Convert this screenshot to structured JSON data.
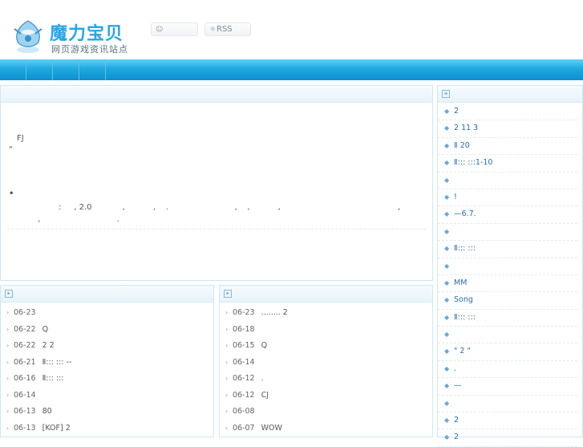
{
  "header": {
    "logo_title": "魔力宝贝",
    "logo_subtitle": "网页游戏资讯站点",
    "user_box_icon": "user-icon",
    "user_box_text": "",
    "rss_icon": "feed-icon",
    "rss_label": "RSS"
  },
  "nav": {
    "items": [
      "",
      "",
      "",
      ""
    ]
  },
  "intro": {
    "lines": [
      "FJ",
      "\"",
      "•",
      ":     , 2.0            ,           ,    .                          ,    ,           ,                                              ,",
      ",                              ."
    ]
  },
  "news_left": [
    {
      "date": "06-23",
      "title": ""
    },
    {
      "date": "06-22",
      "title": "Q"
    },
    {
      "date": "06-22",
      "title": "2     2"
    },
    {
      "date": "06-21",
      "title": "Ⅱ:::  :::  --"
    },
    {
      "date": "06-16",
      "title": "Ⅱ:::  :::"
    },
    {
      "date": "06-14",
      "title": ""
    },
    {
      "date": "06-13",
      "title": "80"
    },
    {
      "date": "06-13",
      "title": "[KOF]    2"
    }
  ],
  "news_right": [
    {
      "date": "06-23",
      "title": "........     2"
    },
    {
      "date": "06-18",
      "title": ""
    },
    {
      "date": "06-15",
      "title": "Q"
    },
    {
      "date": "06-14",
      "title": ""
    },
    {
      "date": "06-12",
      "title": "."
    },
    {
      "date": "06-12",
      "title": "CJ"
    },
    {
      "date": "06-08",
      "title": ""
    },
    {
      "date": "06-07",
      "title": "WOW"
    }
  ],
  "sidebar": [
    "2",
    "2       11 3",
    "Ⅱ 20",
    "Ⅱ:::   :::1-10",
    "",
    "   !",
    "—6.7.",
    "",
    "Ⅱ:::   :::",
    "",
    "MM",
    "         Song",
    "Ⅱ:::   :::",
    "",
    "\"    2   \"",
    "  .",
    "  —",
    "",
    "2",
    "        2"
  ],
  "colors": {
    "accent": "#1fa8e0",
    "link": "#2c6da4",
    "border": "#cfe6f3"
  }
}
